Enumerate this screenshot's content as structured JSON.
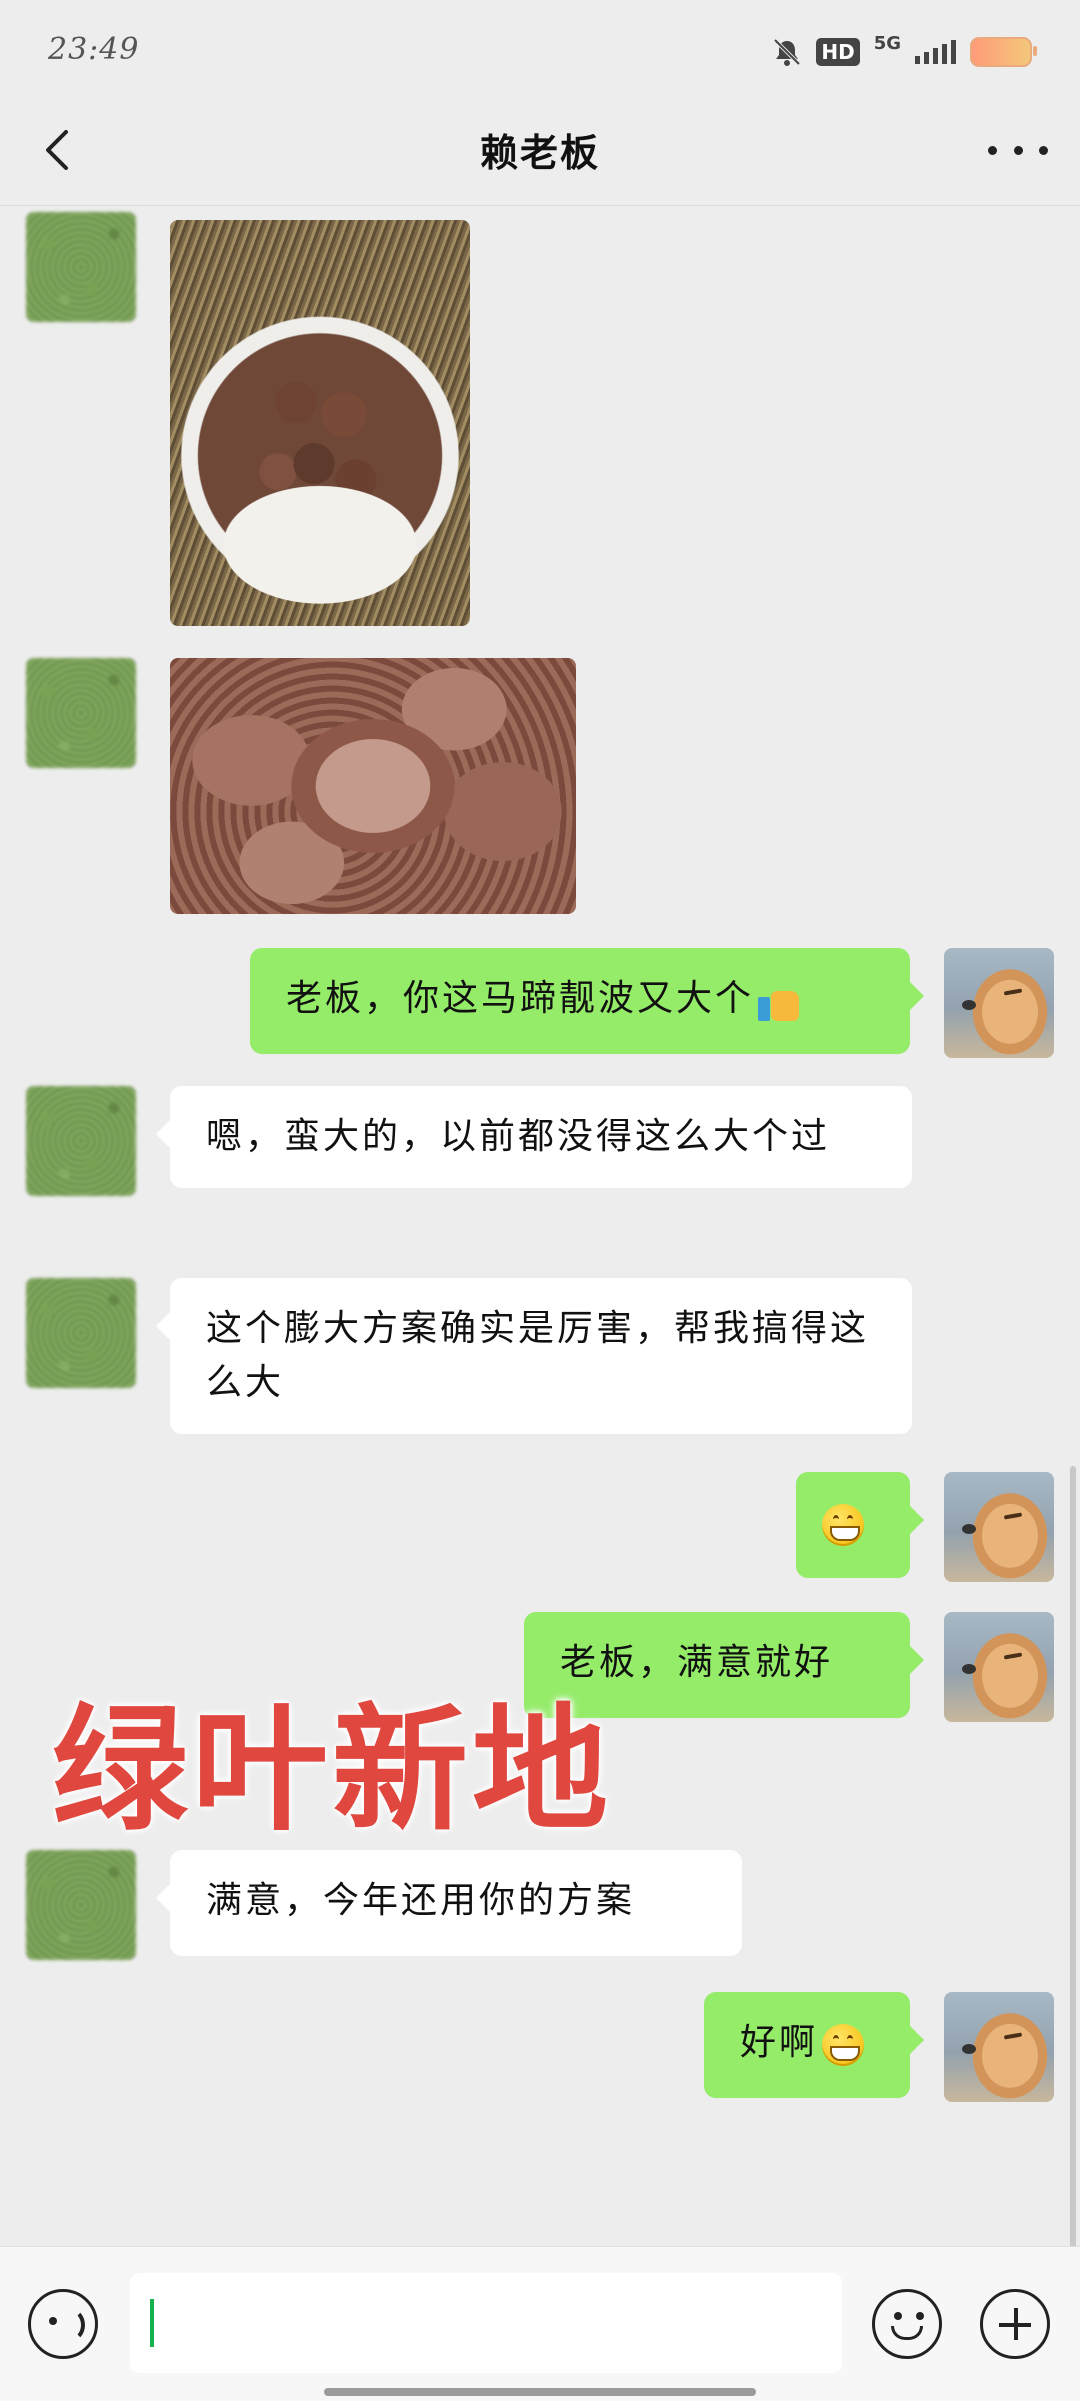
{
  "status_bar": {
    "time": "23:49",
    "hd": "HD",
    "network": "5G",
    "icons": [
      "mute-bell-icon",
      "hd-icon",
      "5g-signal-icon",
      "battery-icon"
    ]
  },
  "header": {
    "title": "赖老板",
    "back_icon": "chevron-left-icon",
    "more_icon": "more-dots-icon"
  },
  "messages": [
    {
      "side": "left",
      "type": "image",
      "content": "photo of water chestnuts in a basin"
    },
    {
      "side": "left",
      "type": "image",
      "content": "photo of harvested water chestnuts"
    },
    {
      "side": "right",
      "type": "text",
      "text": "老板，你这马蹄靓波又大个",
      "emoji": "thumbs-up-icon"
    },
    {
      "side": "left",
      "type": "text",
      "text": "嗯，蛮大的，以前都没得这么大个过"
    },
    {
      "side": "left",
      "type": "text",
      "text": "这个膨大方案确实是厉害，帮我搞得这么大"
    },
    {
      "side": "right",
      "type": "emoji",
      "emoji": "grinning-face-icon"
    },
    {
      "side": "right",
      "type": "text",
      "text": "老板，满意就好"
    },
    {
      "side": "left",
      "type": "text",
      "text": "满意，今年还用你的方案"
    },
    {
      "side": "right",
      "type": "text",
      "text": "好啊",
      "emoji": "grinning-face-icon"
    }
  ],
  "watermark": "绿叶新地",
  "input_bar": {
    "value": "",
    "voice_icon": "voice-icon",
    "emoji_icon": "emoji-icon",
    "plus_icon": "plus-icon"
  },
  "colors": {
    "background": "#ededed",
    "outgoing_bubble": "#95ec69",
    "incoming_bubble": "#ffffff",
    "watermark": "#e0483f"
  }
}
